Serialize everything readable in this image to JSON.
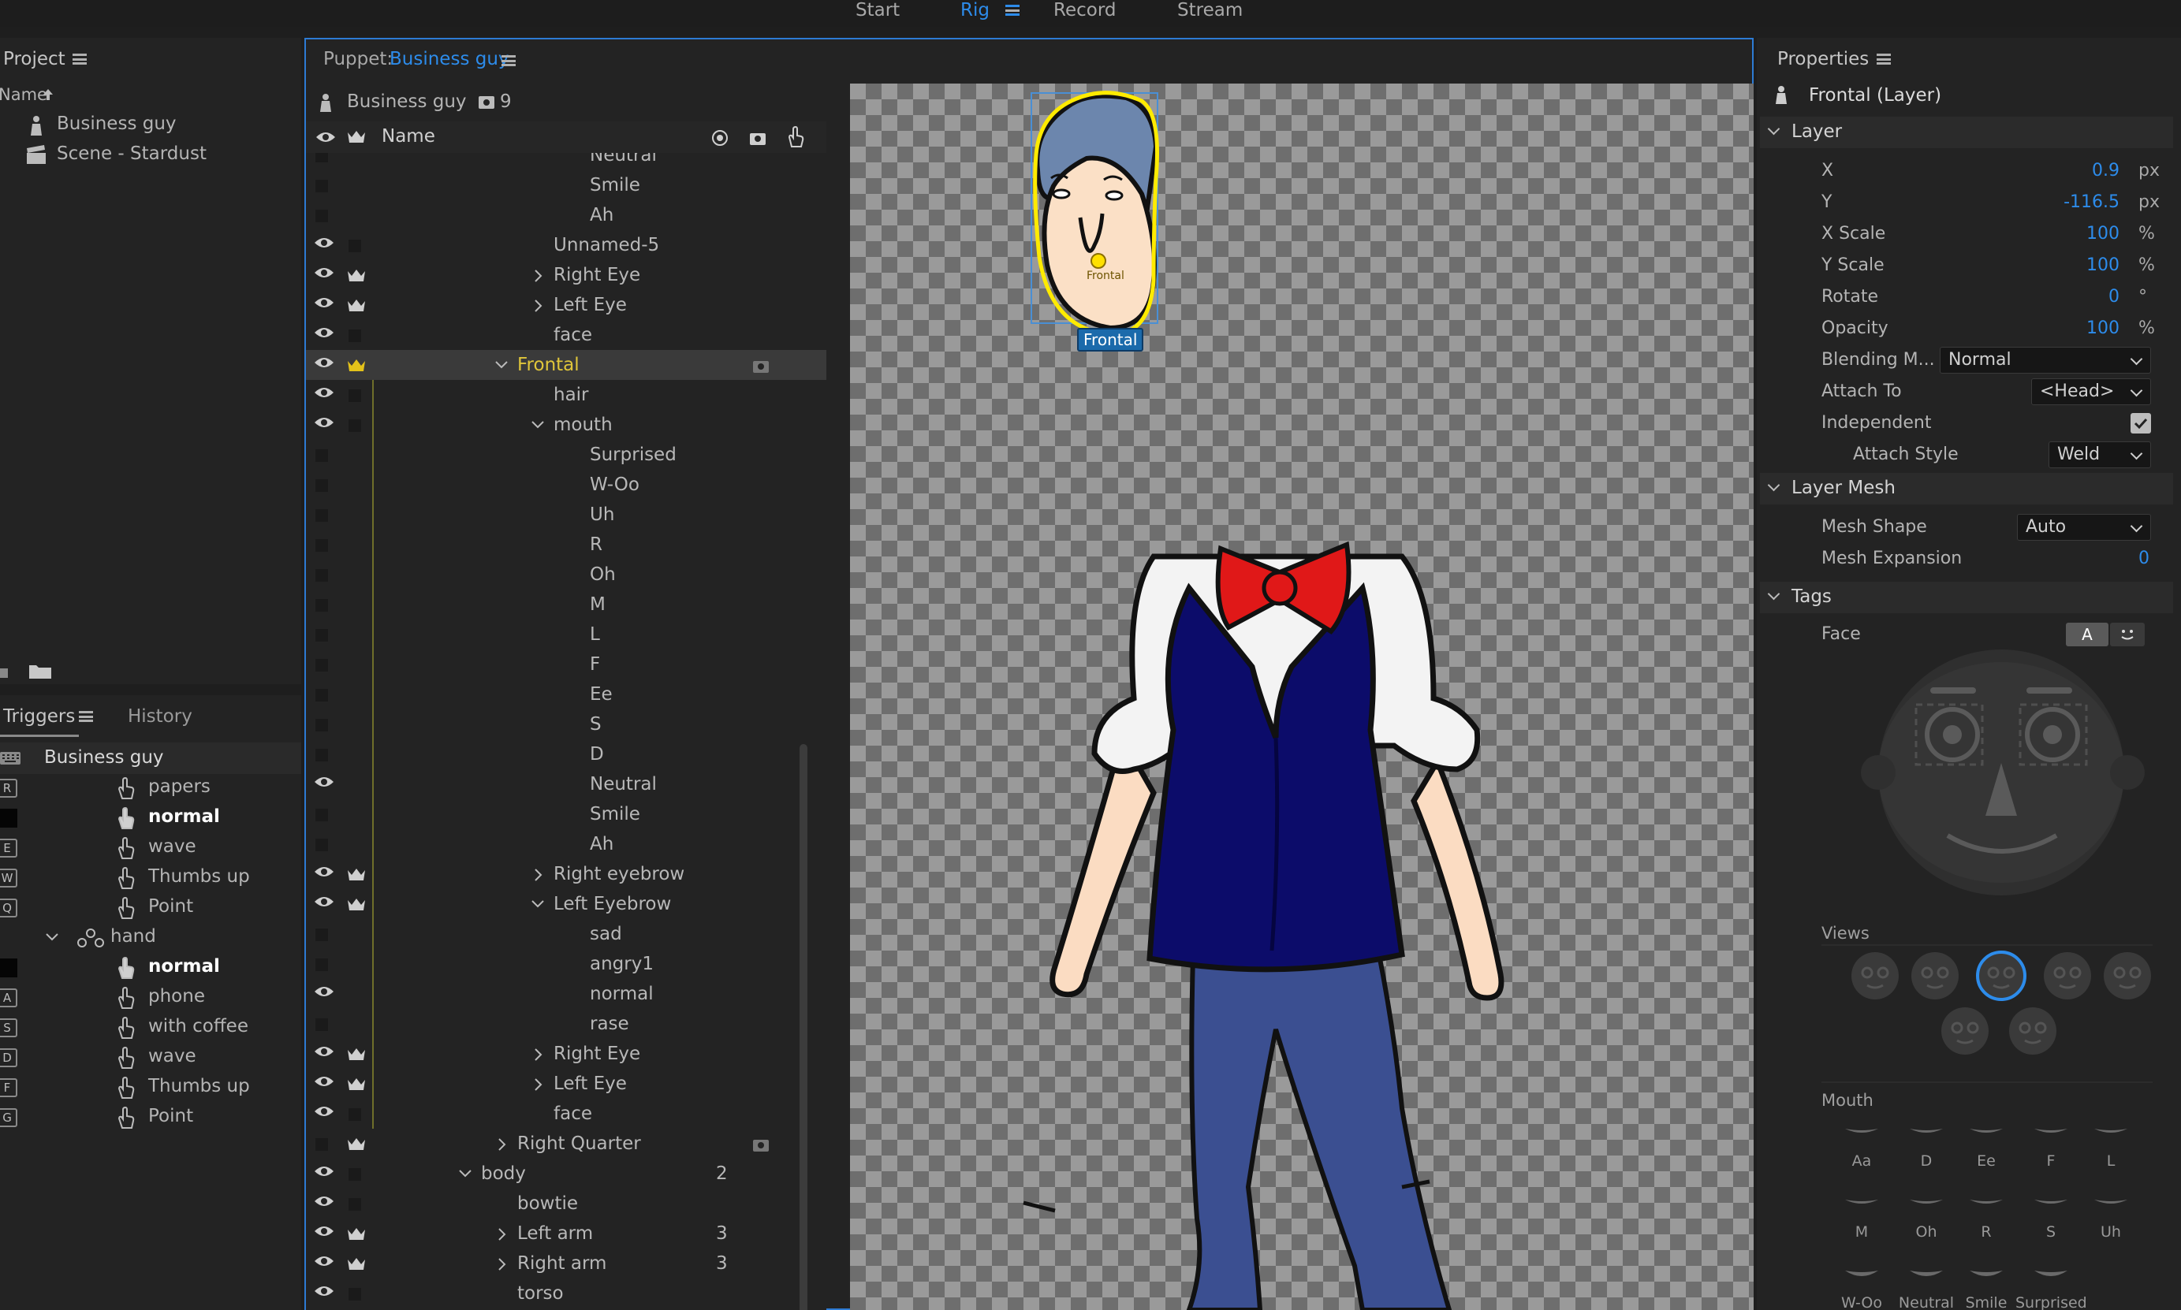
{
  "topbar": {
    "start": "Start",
    "rig": "Rig",
    "record": "Record",
    "stream": "Stream"
  },
  "project": {
    "title": "Project",
    "col_name": "Name",
    "items": [
      "Business guy",
      "Scene - Stardust"
    ]
  },
  "triggers": {
    "title": "Triggers",
    "history": "History",
    "puppet": "Business guy",
    "rows": [
      {
        "key": "R",
        "label": "papers"
      },
      {
        "key": "",
        "label": "normal"
      },
      {
        "key": "E",
        "label": "wave"
      },
      {
        "key": "W",
        "label": "Thumbs up"
      },
      {
        "key": "Q",
        "label": "Point"
      },
      {
        "key": "",
        "label": "hand",
        "group": true
      },
      {
        "key": "",
        "label": "normal"
      },
      {
        "key": "A",
        "label": "phone"
      },
      {
        "key": "S",
        "label": "with coffee"
      },
      {
        "key": "D",
        "label": "wave"
      },
      {
        "key": "F",
        "label": "Thumbs up"
      },
      {
        "key": "G",
        "label": "Point"
      }
    ]
  },
  "puppet": {
    "title_prefix": "Puppet: ",
    "title_name": "Business guy",
    "name": "Business guy",
    "count": "9",
    "col_name": "Name",
    "rows": [
      {
        "label": "Neutral",
        "indent": 4,
        "eye": false
      },
      {
        "label": "Smile",
        "indent": 4,
        "eye": false
      },
      {
        "label": "Ah",
        "indent": 4,
        "eye": false
      },
      {
        "label": "Unnamed-5",
        "indent": 3,
        "eye": true
      },
      {
        "label": "Right Eye",
        "indent": 3,
        "eye": true,
        "crown": true,
        "chev": "right"
      },
      {
        "label": "Left Eye",
        "indent": 3,
        "eye": true,
        "crown": true,
        "chev": "right"
      },
      {
        "label": "face",
        "indent": 3,
        "eye": true
      },
      {
        "label": "Frontal",
        "indent": 2,
        "eye": true,
        "crown": true,
        "chev": "down",
        "selected": true
      },
      {
        "label": "hair",
        "indent": 3,
        "eye": true
      },
      {
        "label": "mouth",
        "indent": 3,
        "eye": true,
        "chev": "down"
      },
      {
        "label": "Surprised",
        "indent": 4
      },
      {
        "label": "W-Oo",
        "indent": 4
      },
      {
        "label": "Uh",
        "indent": 4
      },
      {
        "label": "R",
        "indent": 4
      },
      {
        "label": "Oh",
        "indent": 4
      },
      {
        "label": "M",
        "indent": 4
      },
      {
        "label": "L",
        "indent": 4
      },
      {
        "label": "F",
        "indent": 4
      },
      {
        "label": "Ee",
        "indent": 4
      },
      {
        "label": "S",
        "indent": 4
      },
      {
        "label": "D",
        "indent": 4
      },
      {
        "label": "Neutral",
        "indent": 4,
        "eye": true
      },
      {
        "label": "Smile",
        "indent": 4
      },
      {
        "label": "Ah",
        "indent": 4
      },
      {
        "label": "Right eyebrow",
        "indent": 3,
        "eye": true,
        "crown": true,
        "chev": "right"
      },
      {
        "label": "Left Eyebrow",
        "indent": 3,
        "eye": true,
        "crown": true,
        "chev": "down"
      },
      {
        "label": "sad",
        "indent": 4
      },
      {
        "label": "angry1",
        "indent": 4
      },
      {
        "label": "normal",
        "indent": 4,
        "eye": true
      },
      {
        "label": "rase",
        "indent": 4
      },
      {
        "label": "Right Eye",
        "indent": 3,
        "eye": true,
        "crown": true,
        "chev": "right"
      },
      {
        "label": "Left Eye",
        "indent": 3,
        "eye": true,
        "crown": true,
        "chev": "right"
      },
      {
        "label": "face",
        "indent": 3,
        "eye": true
      },
      {
        "label": "Right Quarter",
        "indent": 2,
        "crown": true,
        "chev": "right",
        "sq": true
      },
      {
        "label": "body",
        "indent": 1,
        "eye": true,
        "chev": "down",
        "num": "2"
      },
      {
        "label": "bowtie",
        "indent": 2,
        "eye": true
      },
      {
        "label": "Left arm",
        "indent": 2,
        "eye": true,
        "crown": true,
        "chev": "right",
        "num": "3"
      },
      {
        "label": "Right arm",
        "indent": 2,
        "eye": true,
        "crown": true,
        "chev": "right",
        "num": "3"
      },
      {
        "label": "torso",
        "indent": 2,
        "eye": true
      }
    ]
  },
  "canvas": {
    "tag_label": "Frontal",
    "handle_label": "Frontal"
  },
  "properties": {
    "title": "Properties",
    "layer_name": "Frontal (Layer)",
    "section_layer": "Layer",
    "x_label": "X",
    "x_value": "0.9",
    "x_unit": "px",
    "y_label": "Y",
    "y_value": "-116.5",
    "y_unit": "px",
    "xs_label": "X Scale",
    "xs_value": "100",
    "xs_unit": "%",
    "ys_label": "Y Scale",
    "ys_value": "100",
    "ys_unit": "%",
    "rot_label": "Rotate",
    "rot_value": "0",
    "rot_unit": "°",
    "op_label": "Opacity",
    "op_value": "100",
    "op_unit": "%",
    "blend_label": "Blending M...",
    "blend_value": "Normal",
    "attach_label": "Attach To",
    "attach_value": "<Head>",
    "indep_label": "Independent",
    "independent": true,
    "astyle_label": "Attach Style",
    "astyle_value": "Weld",
    "section_mesh": "Layer Mesh",
    "mesh_shape_label": "Mesh Shape",
    "mesh_shape_value": "Auto",
    "mesh_exp_label": "Mesh Expansion",
    "mesh_exp_value": "0",
    "section_tags": "Tags",
    "face_label": "Face",
    "face_btn_a": "A",
    "views_label": "Views",
    "mouth_label": "Mouth",
    "mouth_tags": [
      "Aa",
      "D",
      "Ee",
      "F",
      "L",
      "M",
      "Oh",
      "R",
      "S",
      "Uh",
      "W-Oo",
      "Neutral",
      "Smile",
      "Surprised"
    ]
  }
}
